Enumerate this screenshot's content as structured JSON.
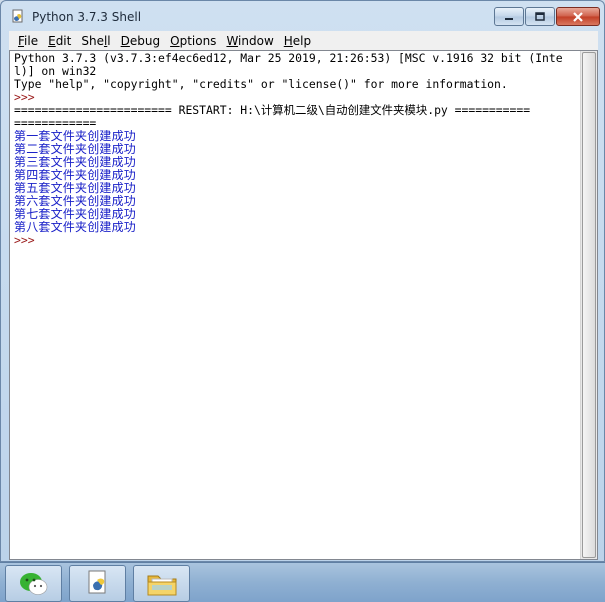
{
  "window": {
    "title": "Python 3.7.3 Shell"
  },
  "menubar": {
    "items": [
      {
        "underline": "F",
        "rest": "ile"
      },
      {
        "underline": "E",
        "rest": "dit"
      },
      {
        "pre": "She",
        "underline": "l",
        "rest": "l"
      },
      {
        "underline": "D",
        "rest": "ebug"
      },
      {
        "underline": "O",
        "rest": "ptions"
      },
      {
        "underline": "W",
        "rest": "indow"
      },
      {
        "underline": "H",
        "rest": "elp"
      }
    ]
  },
  "shell": {
    "lines": [
      {
        "kind": "out",
        "text": "Python 3.7.3 (v3.7.3:ef4ec6ed12, Mar 25 2019, 21:26:53) [MSC v.1916 32 bit (Inte"
      },
      {
        "kind": "out",
        "text": "l)] on win32"
      },
      {
        "kind": "out",
        "text": "Type \"help\", \"copyright\", \"credits\" or \"license()\" for more information."
      },
      {
        "kind": "prompt",
        "text": ">>> "
      },
      {
        "kind": "out",
        "text": "======================= RESTART: H:\\计算机二级\\自动创建文件夹模块.py ==========="
      },
      {
        "kind": "out",
        "text": "============"
      },
      {
        "kind": "stdout",
        "text": "第一套文件夹创建成功"
      },
      {
        "kind": "stdout",
        "text": "第二套文件夹创建成功"
      },
      {
        "kind": "stdout",
        "text": "第三套文件夹创建成功"
      },
      {
        "kind": "stdout",
        "text": "第四套文件夹创建成功"
      },
      {
        "kind": "stdout",
        "text": "第五套文件夹创建成功"
      },
      {
        "kind": "stdout",
        "text": "第六套文件夹创建成功"
      },
      {
        "kind": "stdout",
        "text": "第七套文件夹创建成功"
      },
      {
        "kind": "stdout",
        "text": "第八套文件夹创建成功"
      },
      {
        "kind": "prompt",
        "text": ">>> "
      }
    ]
  },
  "taskbar": {
    "items": [
      {
        "name": "wechat-icon"
      },
      {
        "name": "python-file-icon"
      },
      {
        "name": "folder-icon"
      }
    ]
  },
  "colors": {
    "stdout": "#1a21c8",
    "prompt": "#9a1b1b",
    "text": "#000000"
  }
}
